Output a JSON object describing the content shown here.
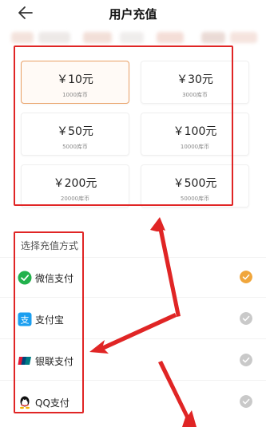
{
  "header": {
    "title": "用户充值",
    "back_icon": "back-arrow-icon"
  },
  "amounts": [
    {
      "price": "￥10元",
      "coins": "1000库币",
      "selected": true
    },
    {
      "price": "￥30元",
      "coins": "3000库币",
      "selected": false
    },
    {
      "price": "￥50元",
      "coins": "5000库币",
      "selected": false
    },
    {
      "price": "￥100元",
      "coins": "10000库币",
      "selected": false
    },
    {
      "price": "￥200元",
      "coins": "20000库币",
      "selected": false
    },
    {
      "price": "￥500元",
      "coins": "50000库币",
      "selected": false
    }
  ],
  "payment": {
    "heading": "选择充值方式",
    "methods": [
      {
        "label": "微信支付",
        "icon": "wechat-pay-icon",
        "selected": true
      },
      {
        "label": "支付宝",
        "icon": "alipay-icon",
        "selected": false
      },
      {
        "label": "银联支付",
        "icon": "unionpay-icon",
        "selected": false
      },
      {
        "label": "QQ支付",
        "icon": "qq-pay-icon",
        "selected": false
      }
    ]
  },
  "colors": {
    "accent": "#e9a167",
    "highlight": "#e02525",
    "check_selected": "#f0a63c",
    "check_unselected": "#c9c9c9"
  }
}
